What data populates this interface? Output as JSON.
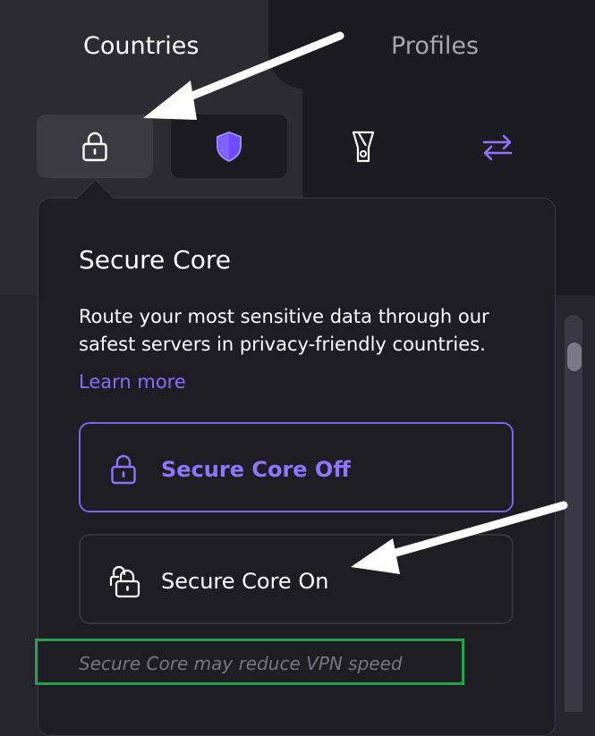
{
  "tabs": [
    {
      "label": "Countries",
      "active": true
    },
    {
      "label": "Profiles",
      "active": false
    }
  ],
  "filters": [
    {
      "icon": "lock-icon",
      "active": true
    },
    {
      "icon": "shield-icon",
      "active": false
    },
    {
      "icon": "tor-icon",
      "active": false
    },
    {
      "icon": "p2p-arrows-icon",
      "active": false
    }
  ],
  "popover": {
    "title": "Secure Core",
    "description": "Route your most sensitive data through our safest servers in privacy-friendly countries.",
    "learn_more": "Learn more",
    "option_off": "Secure Core Off",
    "option_on": "Secure Core On",
    "note": "Secure Core may reduce VPN speed"
  },
  "colors": {
    "accent": "#8b6cff",
    "annotation_box": "#24a149",
    "annotation_arrows": "#ffffff"
  }
}
